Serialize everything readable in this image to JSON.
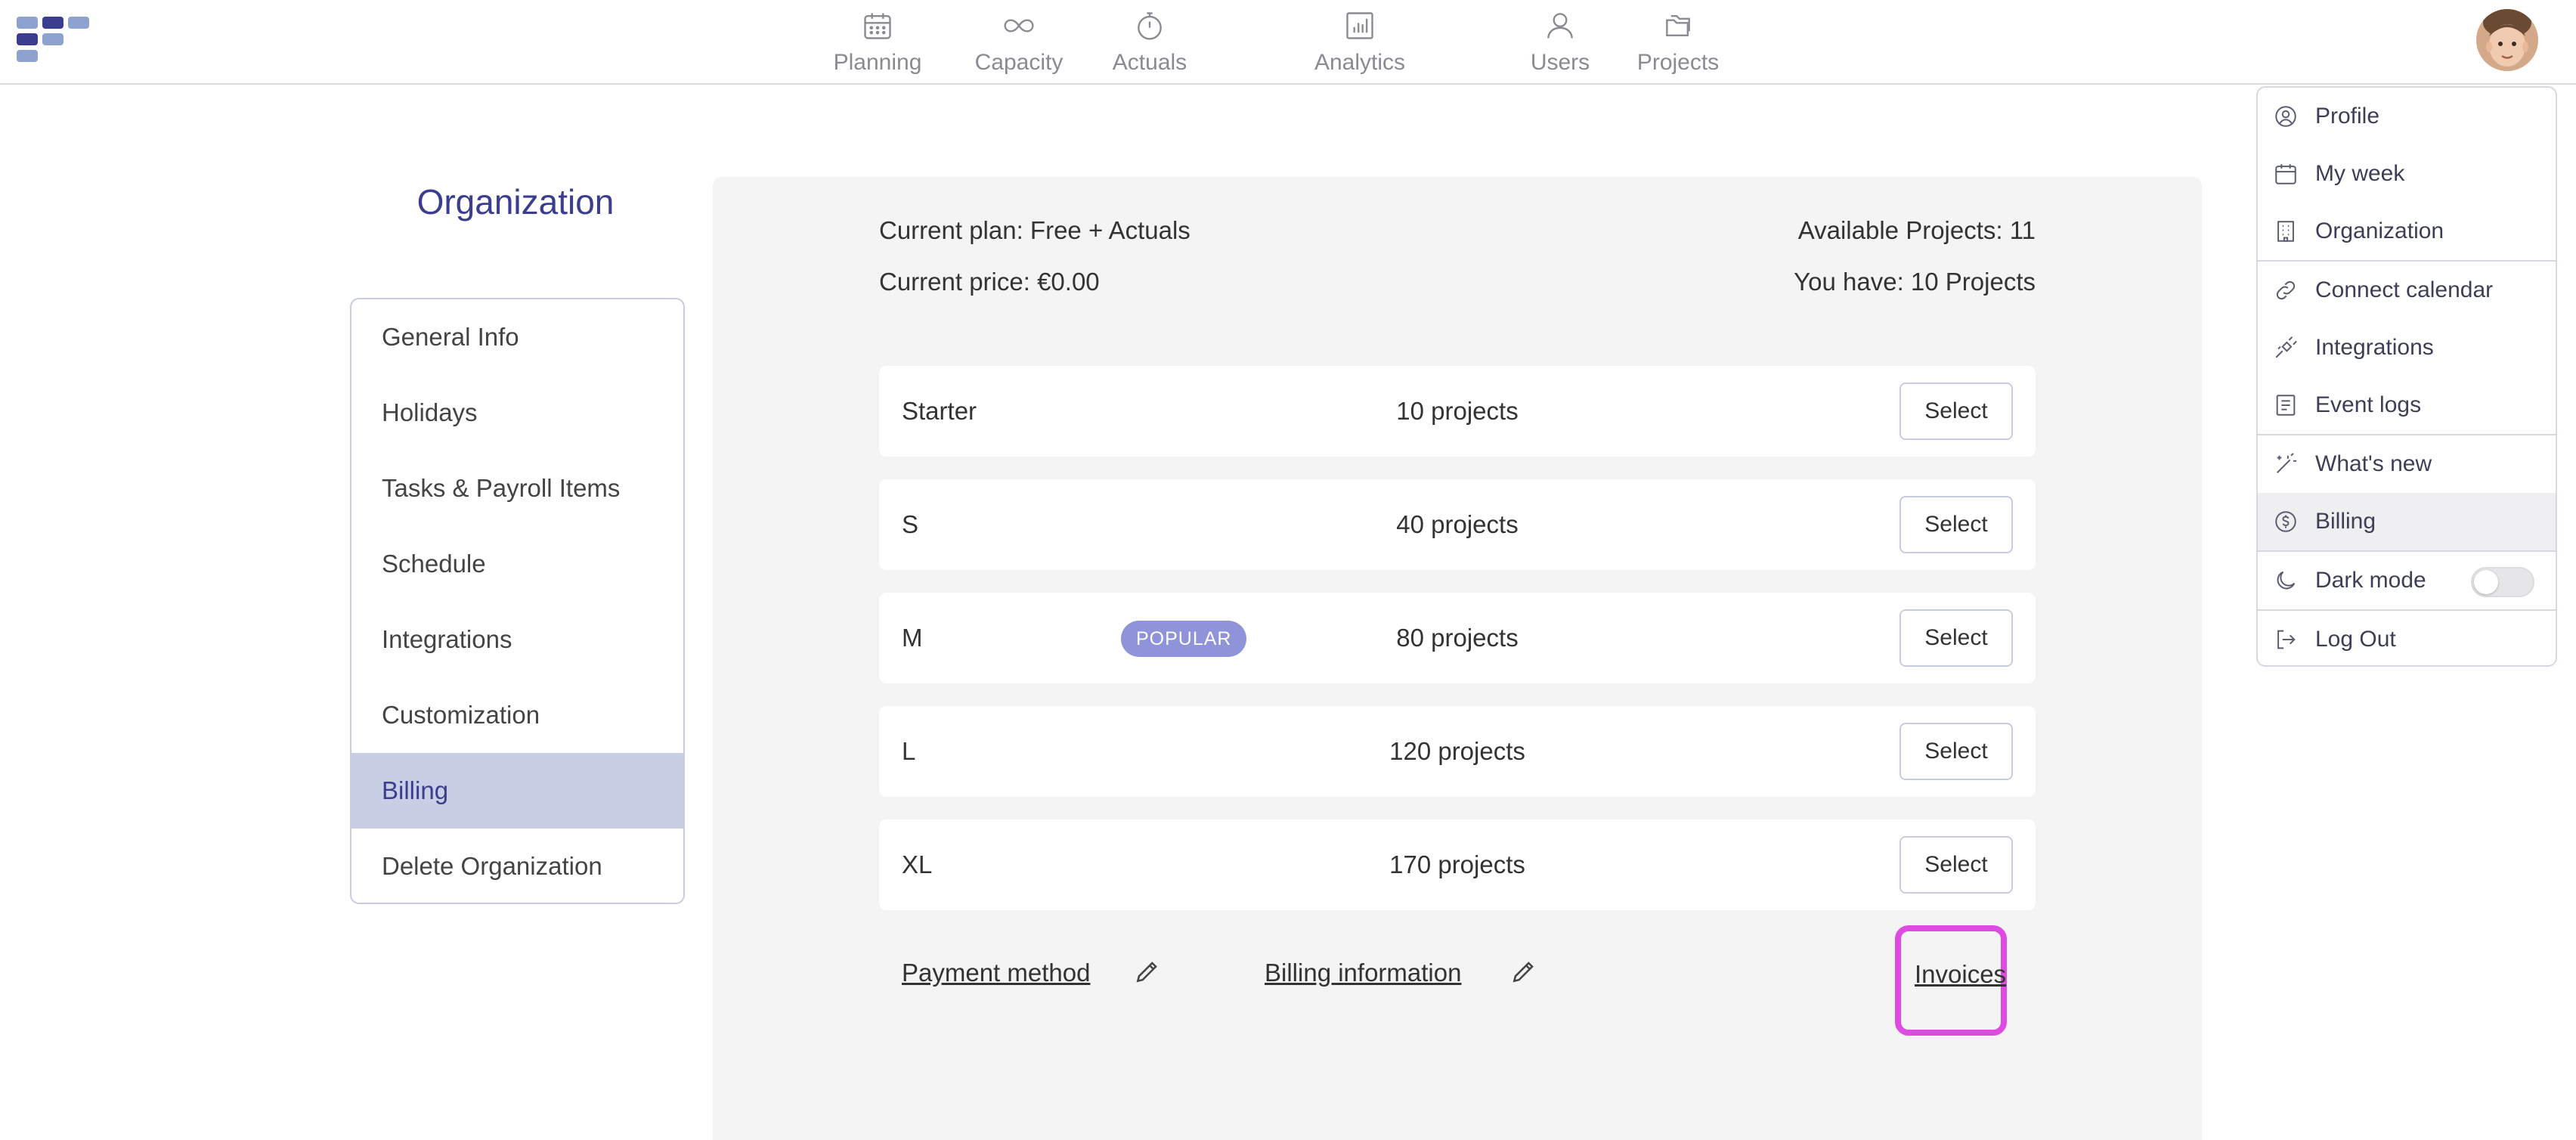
{
  "nav": {
    "items": [
      {
        "label": "Planning",
        "icon": "calendar-icon"
      },
      {
        "label": "Capacity",
        "icon": "infinity-icon"
      },
      {
        "label": "Actuals",
        "icon": "stopwatch-icon"
      },
      {
        "label": "Analytics",
        "icon": "bar-chart-icon"
      },
      {
        "label": "Users",
        "icon": "user-icon"
      },
      {
        "label": "Projects",
        "icon": "folders-icon"
      }
    ]
  },
  "sidebar": {
    "title": "Organization",
    "items": [
      {
        "label": "General Info"
      },
      {
        "label": "Holidays"
      },
      {
        "label": "Tasks & Payroll Items"
      },
      {
        "label": "Schedule"
      },
      {
        "label": "Integrations"
      },
      {
        "label": "Customization"
      },
      {
        "label": "Billing",
        "active": true
      },
      {
        "label": "Delete Organization"
      }
    ]
  },
  "billing": {
    "current_plan": "Current plan: Free + Actuals",
    "current_price": "Current price: €0.00",
    "available_projects": "Available Projects: 11",
    "you_have": "You have: 10 Projects",
    "plans": [
      {
        "name": "Starter",
        "projects": "10 projects",
        "button": "Select"
      },
      {
        "name": "S",
        "projects": "40 projects",
        "button": "Select"
      },
      {
        "name": "M",
        "projects": "80 projects",
        "button": "Select",
        "badge": "POPULAR"
      },
      {
        "name": "L",
        "projects": "120 projects",
        "button": "Select"
      },
      {
        "name": "XL",
        "projects": "170 projects",
        "button": "Select"
      }
    ],
    "payment_method": "Payment method",
    "billing_information": "Billing information",
    "invoices": "Invoices"
  },
  "dropdown": {
    "items": [
      {
        "label": "Profile",
        "icon": "user-circle-icon"
      },
      {
        "label": "My week",
        "icon": "calendar-icon"
      },
      {
        "label": "Organization",
        "icon": "building-icon"
      },
      {
        "label": "Connect calendar",
        "icon": "link-icon"
      },
      {
        "label": "Integrations",
        "icon": "plug-icon"
      },
      {
        "label": "Event logs",
        "icon": "document-icon"
      },
      {
        "label": "What's new",
        "icon": "magic-wand-icon"
      },
      {
        "label": "Billing",
        "icon": "dollar-circle-icon",
        "active": true
      },
      {
        "label": "Dark mode",
        "icon": "moon-icon",
        "toggle": false
      },
      {
        "label": "Log Out",
        "icon": "logout-icon"
      }
    ]
  },
  "colors": {
    "accent": "#3b3d8f",
    "active_bg": "#c8cee3",
    "popular_badge": "#8f93d9",
    "highlight": "#de4be0",
    "panel_bg": "#f4f4f5"
  }
}
